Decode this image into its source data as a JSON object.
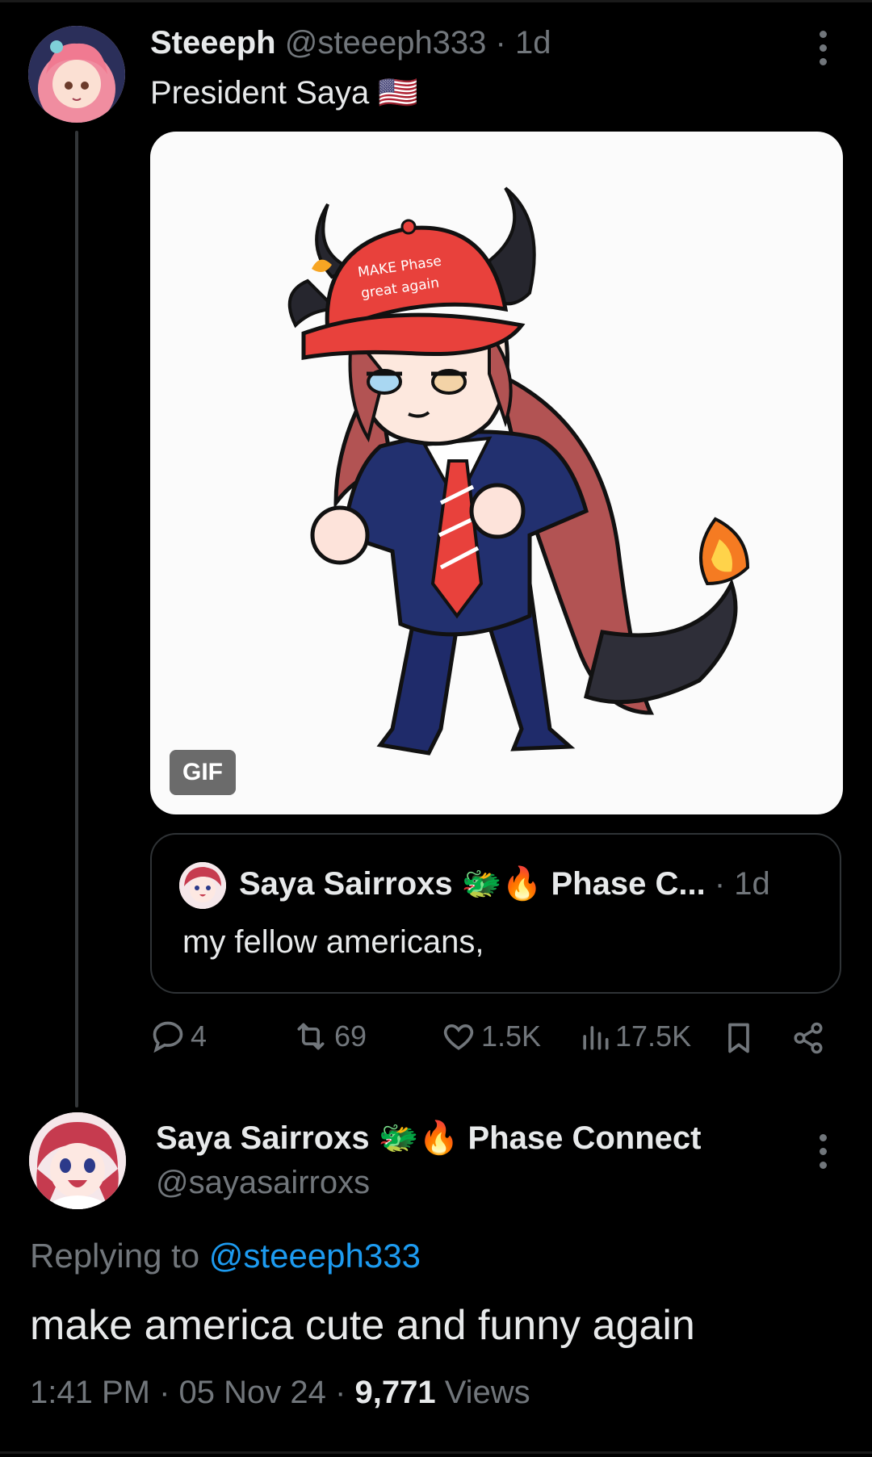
{
  "tweet": {
    "author_name": "Steeeph",
    "handle": "@steeeph333",
    "sep": "·",
    "age": "1d",
    "text": "President Saya 🇺🇸",
    "media_badge": "GIF",
    "cap_text_line1": "MAKE Phase",
    "cap_text_line2": "great again",
    "quote": {
      "author_name": "Saya Sairroxs",
      "emoji": "🐲🔥",
      "author_suffix": "Phase C...",
      "sep": "·",
      "age": "1d",
      "text": "my fellow americans,"
    },
    "actions": {
      "replies": "4",
      "reposts": "69",
      "likes": "1.5K",
      "views": "17.5K"
    }
  },
  "reply": {
    "author_name": "Saya Sairroxs",
    "emoji": "🐲🔥",
    "author_suffix": "Phase Connect",
    "handle": "@sayasairroxs",
    "replying_prefix": "Replying to",
    "replying_to": "@steeeph333",
    "text": "make america cute and funny again",
    "time": "1:41 PM",
    "sep1": "·",
    "date": "05 Nov 24",
    "sep2": "·",
    "views_count": "9,771",
    "views_label": "Views"
  },
  "colors": {
    "background": "#000000",
    "text": "#e7e9ea",
    "muted": "#71767b",
    "link": "#1d9bf0",
    "border": "#2f3336"
  }
}
